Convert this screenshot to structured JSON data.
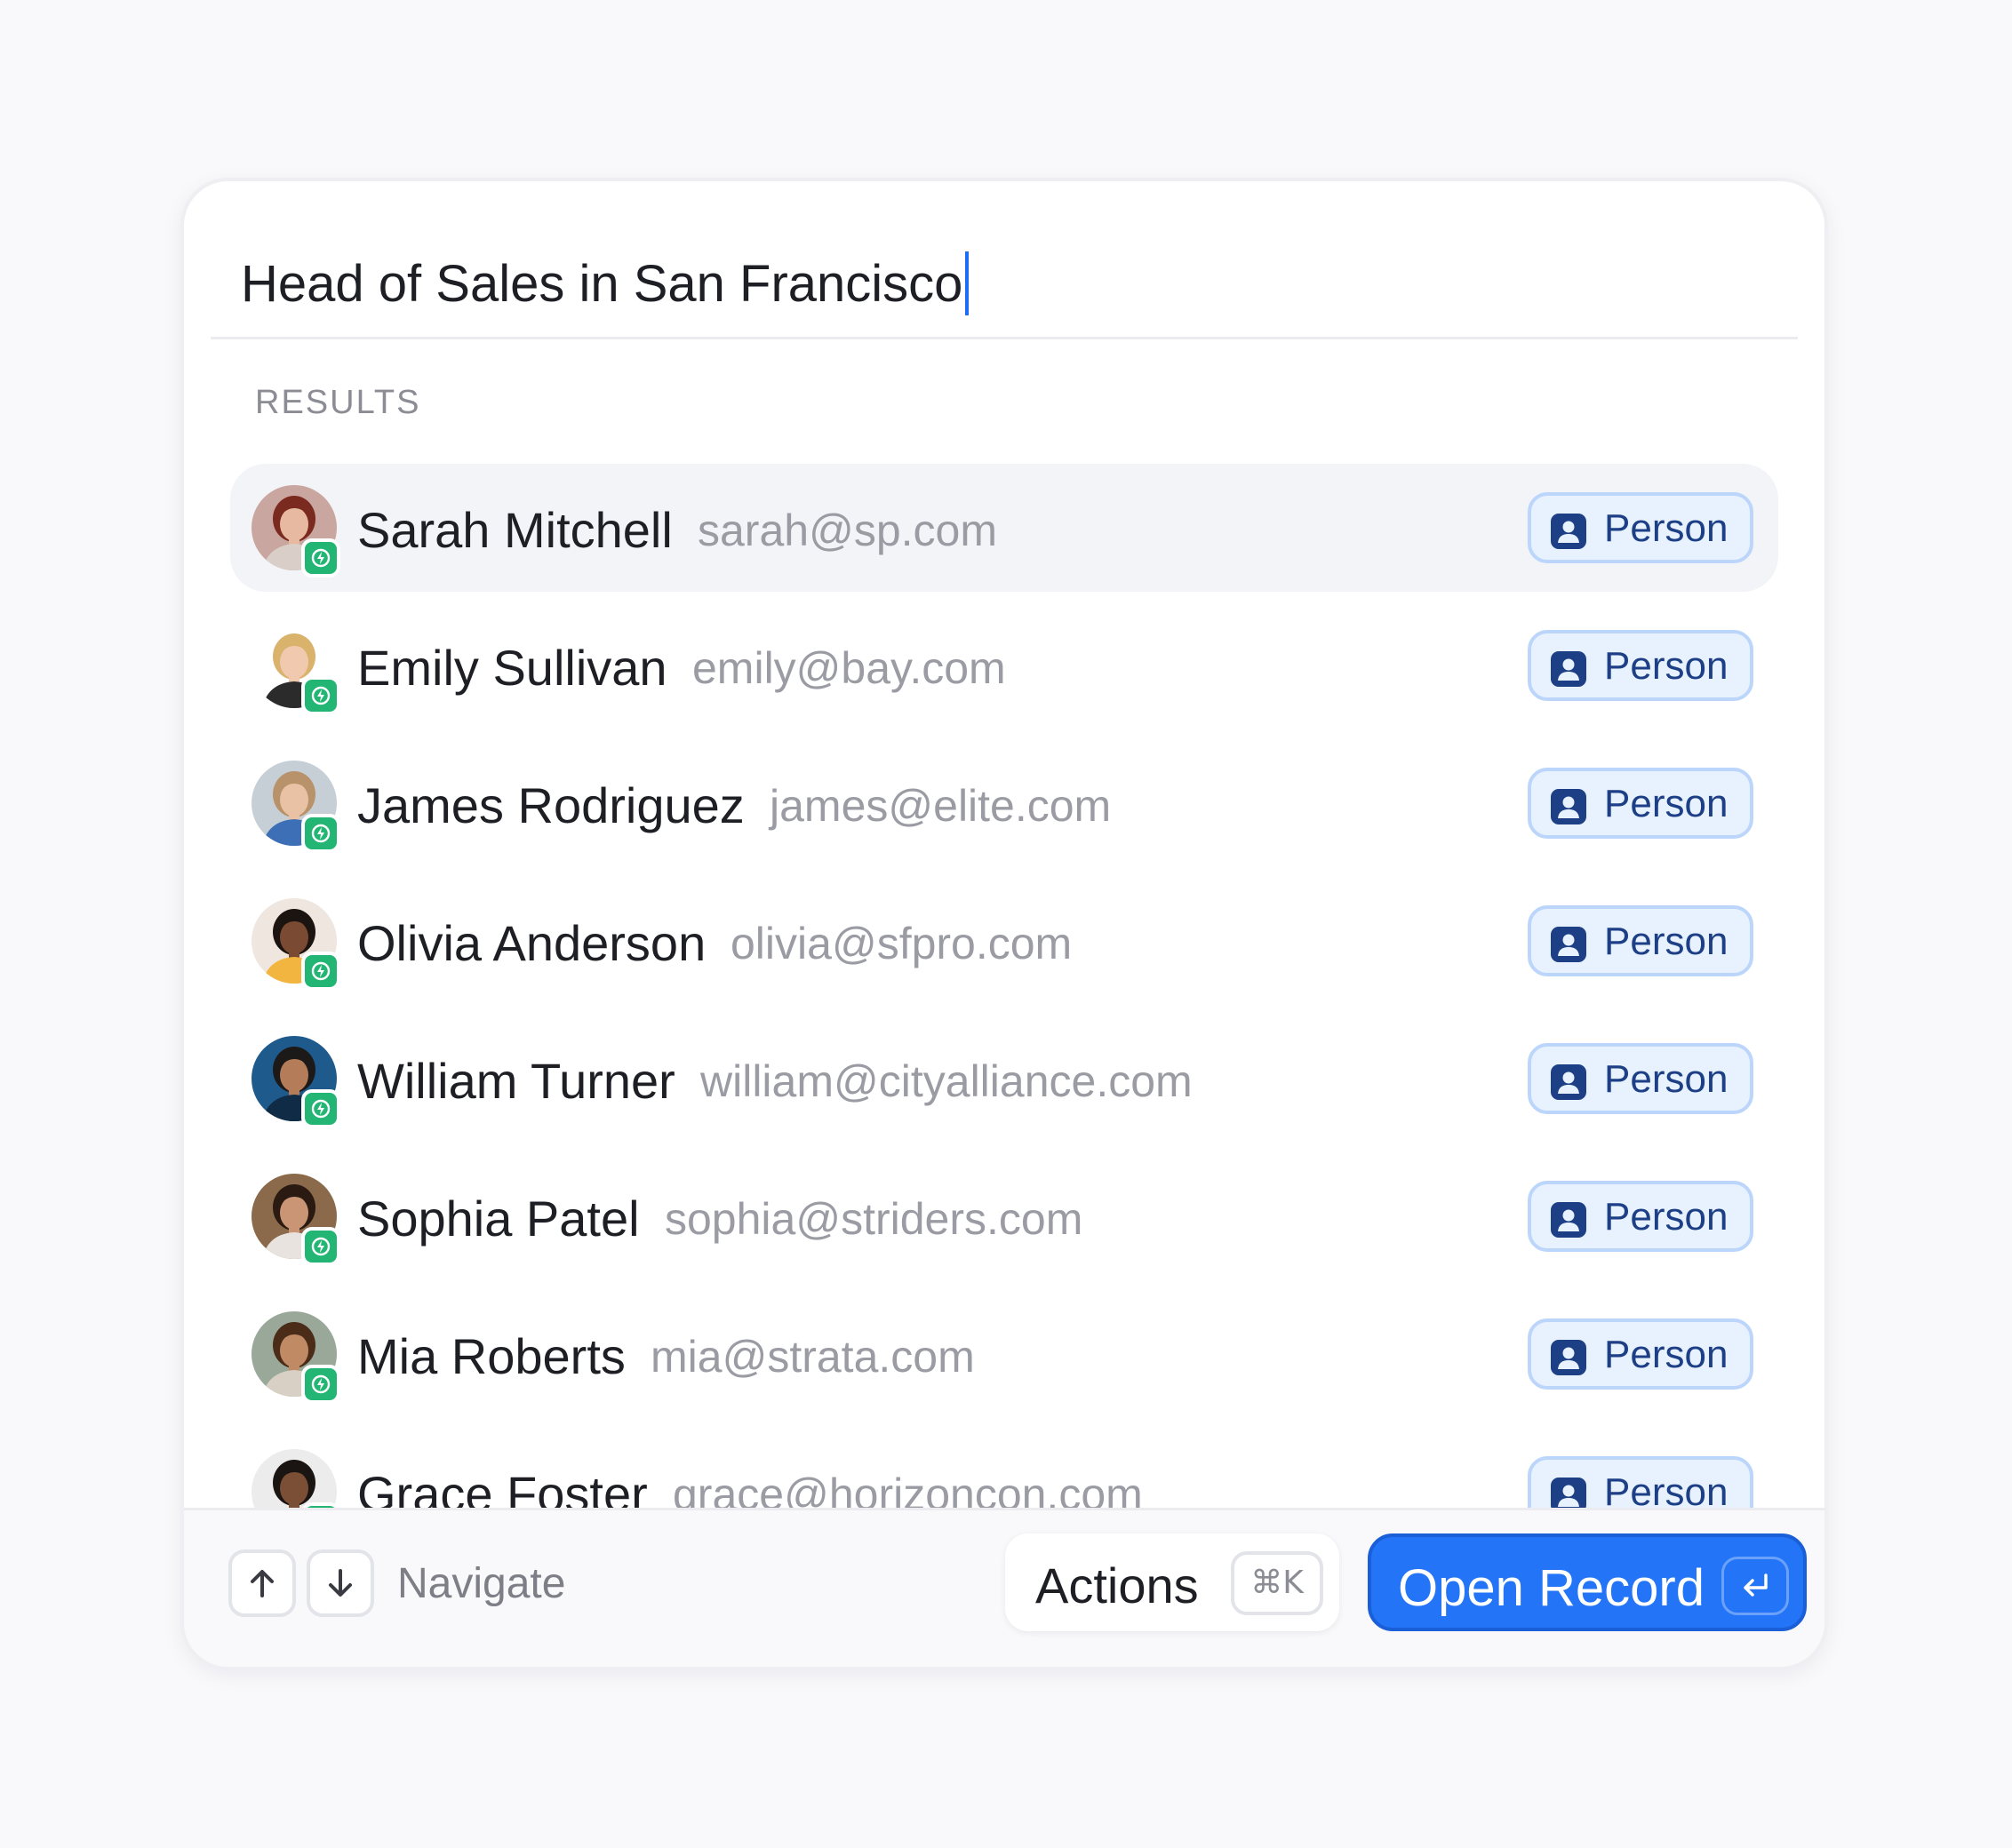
{
  "search": {
    "query": "Head of Sales in San Francisco"
  },
  "results_label": "RESULTS",
  "results": [
    {
      "name": "Sarah Mitchell",
      "email": "sarah@sp.com",
      "type": "Person",
      "selected": true,
      "skin": "#e7b9a0",
      "hair": "#7a2a1e",
      "bg": "#c9a6a0",
      "shirt": "#d9cfc8"
    },
    {
      "name": "Emily Sullivan",
      "email": "emily@bay.com",
      "type": "Person",
      "selected": false,
      "skin": "#f1c9ae",
      "hair": "#d9b36c",
      "bg": "#ffffff",
      "shirt": "#2b2b2b"
    },
    {
      "name": "James Rodriguez",
      "email": "james@elite.com",
      "type": "Person",
      "selected": false,
      "skin": "#e9c2a6",
      "hair": "#b8926a",
      "bg": "#c7cfd6",
      "shirt": "#3c6fb6"
    },
    {
      "name": "Olivia Anderson",
      "email": "olivia@sfpro.com",
      "type": "Person",
      "selected": false,
      "skin": "#7a4a32",
      "hair": "#1b1410",
      "bg": "#efe6df",
      "shirt": "#f2b640"
    },
    {
      "name": "William Turner",
      "email": "william@cityalliance.com",
      "type": "Person",
      "selected": false,
      "skin": "#b47c58",
      "hair": "#1c1a18",
      "bg": "#1f5a8c",
      "shirt": "#0f2b45"
    },
    {
      "name": "Sophia Patel",
      "email": "sophia@striders.com",
      "type": "Person",
      "selected": false,
      "skin": "#c99575",
      "hair": "#2a1a12",
      "bg": "#8a6a4a",
      "shirt": "#e8e3de"
    },
    {
      "name": "Mia Roberts",
      "email": "mia@strata.com",
      "type": "Person",
      "selected": false,
      "skin": "#c08a64",
      "hair": "#4a2c18",
      "bg": "#9aa89a",
      "shirt": "#d8d0c4"
    },
    {
      "name": "Grace Foster",
      "email": "grace@horizoncon.com",
      "type": "Person",
      "selected": false,
      "skin": "#7b4e36",
      "hair": "#1a1412",
      "bg": "#ececec",
      "shirt": "#2b2b2b"
    }
  ],
  "footer": {
    "navigate_label": "Navigate",
    "actions_label": "Actions",
    "actions_shortcut": "⌘K",
    "open_label": "Open Record"
  },
  "colors": {
    "accent": "#2374f6",
    "badge_bg": "#e8f1fe",
    "badge_text": "#1d3f86",
    "bolt": "#22b573"
  }
}
